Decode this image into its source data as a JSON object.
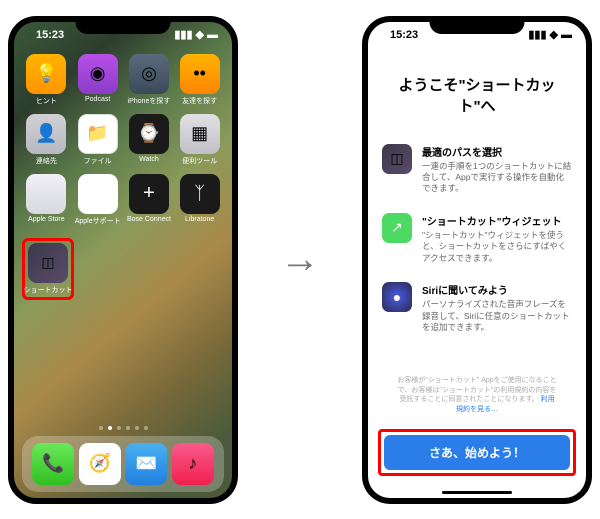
{
  "status": {
    "time": "15:23"
  },
  "homescreen": {
    "apps": [
      {
        "label": "ヒント",
        "icon": "tips"
      },
      {
        "label": "Podcast",
        "icon": "podcast"
      },
      {
        "label": "iPhoneを探す",
        "icon": "findphone"
      },
      {
        "label": "友達を探す",
        "icon": "friends"
      },
      {
        "label": "連絡先",
        "icon": "contacts"
      },
      {
        "label": "ファイル",
        "icon": "files"
      },
      {
        "label": "Watch",
        "icon": "watch"
      },
      {
        "label": "便利ツール",
        "icon": "tools"
      },
      {
        "label": "Apple Store",
        "icon": "appstore"
      },
      {
        "label": "Appleサポート",
        "icon": "support"
      },
      {
        "label": "Bose Connect",
        "icon": "bose"
      },
      {
        "label": "Libratone",
        "icon": "libratone"
      }
    ],
    "highlighted_app": {
      "label": "ショートカット",
      "icon": "shortcuts"
    },
    "dock": [
      {
        "icon": "phone",
        "name": "phone"
      },
      {
        "icon": "safari",
        "name": "safari"
      },
      {
        "icon": "mail",
        "name": "mail"
      },
      {
        "icon": "music",
        "name": "music"
      }
    ]
  },
  "welcome": {
    "title": "ようこそ\"ショートカット\"へ",
    "features": [
      {
        "icon": "shortcuts",
        "title": "最適のパスを選択",
        "desc": "一連の手順を1つのショートカットに結合して、Appで実行する操作を自動化できます。"
      },
      {
        "icon": "widget",
        "title": "\"ショートカット\"ウィジェット",
        "desc": "\"ショートカット\"ウィジェットを使うと、ショートカットをさらにすばやくアクセスできます。"
      },
      {
        "icon": "siri",
        "title": "Siriに聞いてみよう",
        "desc": "パーソナライズされた音声フレーズを録音して、Siriに任意のショートカットを追加できます。"
      }
    ],
    "terms_text": "お客様が\"ショートカット\" Appをご使用になることで、お客様は\"ショートカット\"の利用規約の内容を受託することに同意されたことになります。",
    "terms_link": "利用規約を見る…",
    "cta": "さあ、始めよう！"
  }
}
